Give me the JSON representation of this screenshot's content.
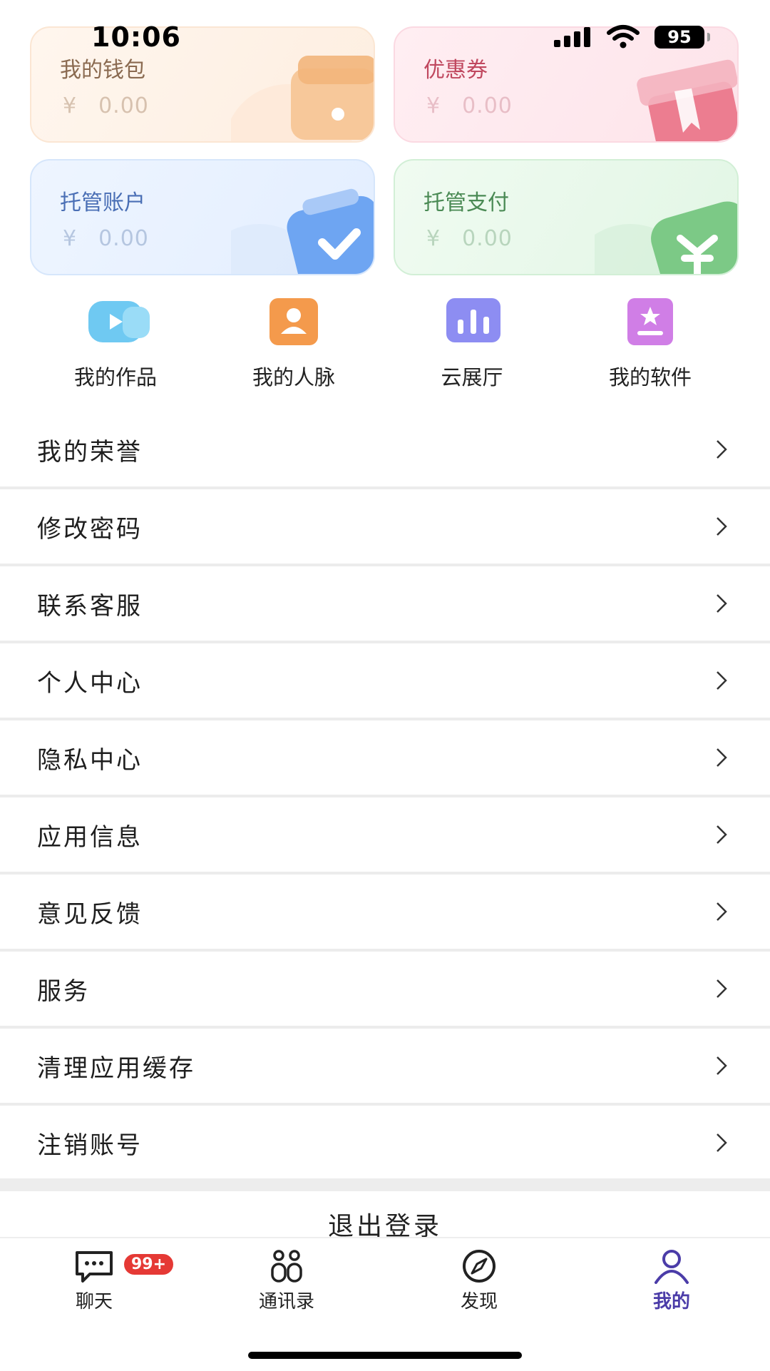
{
  "status": {
    "time": "10:06",
    "battery": "95"
  },
  "cards": {
    "wallet": {
      "title": "我的钱包",
      "currency": "¥",
      "amount": "0.00"
    },
    "coupon": {
      "title": "优惠券",
      "currency": "¥",
      "amount": "0.00"
    },
    "escrow_account": {
      "title": "托管账户",
      "currency": "¥",
      "amount": "0.00"
    },
    "escrow_pay": {
      "title": "托管支付",
      "currency": "¥",
      "amount": "0.00"
    }
  },
  "shortcuts": [
    {
      "label": "我的作品",
      "icon": "video-icon"
    },
    {
      "label": "我的人脉",
      "icon": "contact-card-icon"
    },
    {
      "label": "云展厅",
      "icon": "bar-chart-icon"
    },
    {
      "label": "我的软件",
      "icon": "bookmark-star-icon"
    }
  ],
  "menu": [
    {
      "label": "我的荣誉"
    },
    {
      "label": "修改密码"
    },
    {
      "label": "联系客服"
    },
    {
      "label": "个人中心"
    },
    {
      "label": "隐私中心"
    },
    {
      "label": "应用信息"
    },
    {
      "label": "意见反馈"
    },
    {
      "label": "服务"
    },
    {
      "label": "清理应用缓存"
    },
    {
      "label": "注销账号"
    }
  ],
  "logout": "退出登录",
  "tabs": [
    {
      "label": "聊天",
      "icon": "chat-icon",
      "badge": "99+"
    },
    {
      "label": "通讯录",
      "icon": "contacts-icon"
    },
    {
      "label": "发现",
      "icon": "compass-icon"
    },
    {
      "label": "我的",
      "icon": "user-icon",
      "active": true
    }
  ],
  "colors": {
    "accent": "#4b3ca8",
    "badge": "#e53935"
  }
}
